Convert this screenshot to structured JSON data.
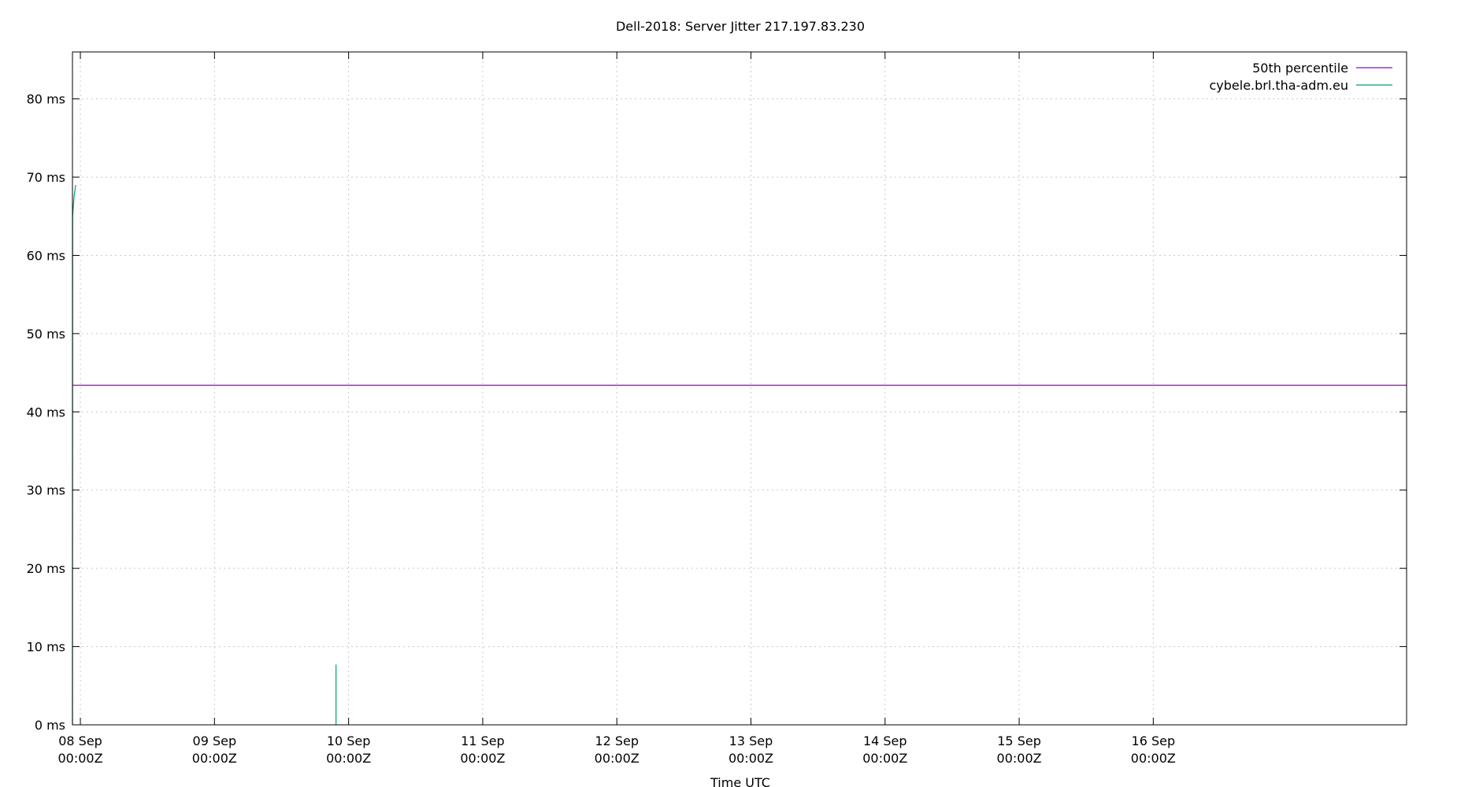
{
  "chart_data": {
    "type": "line",
    "title": "Dell-2018: Server Jitter 217.197.83.230",
    "xlabel": "Time UTC",
    "ylabel": "",
    "ylim": [
      0,
      86
    ],
    "xlim": [
      "2023-09-07T22:35Z",
      "2023-09-17T21:20Z"
    ],
    "grid": true,
    "legend_position": "top-right",
    "y_ticks": [
      {
        "value": 0,
        "label": "0 ms"
      },
      {
        "value": 10,
        "label": "10 ms"
      },
      {
        "value": 20,
        "label": "20 ms"
      },
      {
        "value": 30,
        "label": "30 ms"
      },
      {
        "value": 40,
        "label": "40 ms"
      },
      {
        "value": 50,
        "label": "50 ms"
      },
      {
        "value": 60,
        "label": "60 ms"
      },
      {
        "value": 70,
        "label": "70 ms"
      },
      {
        "value": 80,
        "label": "80 ms"
      }
    ],
    "x_ticks": [
      {
        "value": "2023-09-08T00:00Z",
        "line1": "08 Sep",
        "line2": "00:00Z"
      },
      {
        "value": "2023-09-09T00:00Z",
        "line1": "09 Sep",
        "line2": "00:00Z"
      },
      {
        "value": "2023-09-10T00:00Z",
        "line1": "10 Sep",
        "line2": "00:00Z"
      },
      {
        "value": "2023-09-11T00:00Z",
        "line1": "11 Sep",
        "line2": "00:00Z"
      },
      {
        "value": "2023-09-12T00:00Z",
        "line1": "12 Sep",
        "line2": "00:00Z"
      },
      {
        "value": "2023-09-13T00:00Z",
        "line1": "13 Sep",
        "line2": "00:00Z"
      },
      {
        "value": "2023-09-14T00:00Z",
        "line1": "14 Sep",
        "line2": "00:00Z"
      },
      {
        "value": "2023-09-15T00:00Z",
        "line1": "15 Sep",
        "line2": "00:00Z"
      },
      {
        "value": "2023-09-16T00:00Z",
        "line1": "16 Sep",
        "line2": "00:00Z"
      }
    ],
    "series": [
      {
        "name": "50th percentile",
        "color": "#9400d3",
        "points": [
          {
            "x": "2023-09-07T22:35Z",
            "y": 43.4
          },
          {
            "x": "2023-09-17T21:20Z",
            "y": 43.4
          }
        ]
      },
      {
        "name": "cybele.brl.tha-adm.eu",
        "color": "#009e73",
        "points": [
          {
            "x": "2023-09-07T22:35Z",
            "y": 0.0
          },
          {
            "x": "2023-09-07T22:37Z",
            "y": 65.0
          },
          {
            "x": "2023-09-07T22:52Z",
            "y": 67.5
          },
          {
            "x": "2023-09-07T23:10Z",
            "y": 69.0
          }
        ],
        "spikes": [
          {
            "x": "2023-09-09T21:45Z",
            "y": 7.7
          }
        ]
      }
    ]
  }
}
